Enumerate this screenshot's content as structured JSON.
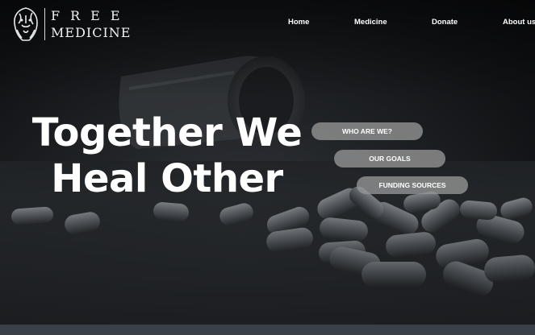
{
  "brand": {
    "line1": "FREE",
    "line2": "MEDICINE",
    "logo_icon": "lion-head-icon"
  },
  "nav": {
    "items": [
      {
        "label": "Home"
      },
      {
        "label": "Medicine"
      },
      {
        "label": "Donate"
      },
      {
        "label": "About us"
      }
    ]
  },
  "hero": {
    "headline": "Together We Heal Other",
    "buttons": [
      {
        "label": "WHO ARE WE?"
      },
      {
        "label": "OUR GOALS"
      },
      {
        "label": "FUNDING SOURCES"
      }
    ]
  },
  "colors": {
    "overlay": "#15171a",
    "pill": "#969696",
    "text": "#ffffff",
    "footer_strip": "#3b3f47"
  }
}
